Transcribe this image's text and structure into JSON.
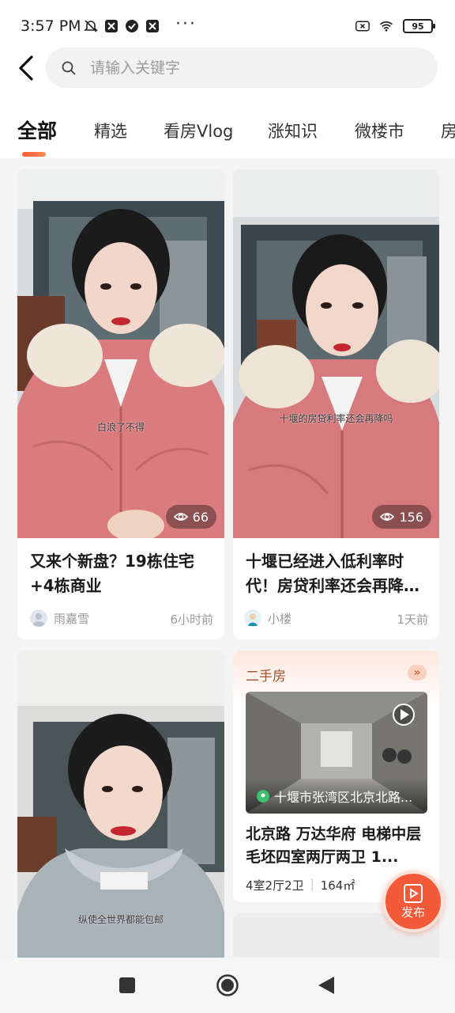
{
  "status_bar": {
    "time": "3:57 PM",
    "battery": "95",
    "dots": "···"
  },
  "search": {
    "placeholder": "请输入关键字"
  },
  "tabs": [
    {
      "label": "全部",
      "active": true
    },
    {
      "label": "精选"
    },
    {
      "label": "看房Vlog"
    },
    {
      "label": "涨知识"
    },
    {
      "label": "微楼市"
    },
    {
      "label": "房"
    }
  ],
  "cards": [
    {
      "title": "又来个新盘？19栋住宅+4栋商业",
      "subtitle_overlay": "白浪了不得",
      "views": "66",
      "author": "雨嘉雪",
      "time": "6小时前"
    },
    {
      "title": "十堰已经进入低利率时代！房贷利率还会再降…",
      "subtitle_overlay": "十堰的房贷利率还会再降吗",
      "views": "156",
      "author": "小楼",
      "time": "1天前"
    },
    {
      "subtitle_overlay": "纵使全世界都能包邮"
    }
  ],
  "house_card": {
    "tag": "二手房",
    "more_icon": "»",
    "location": "十堰市张湾区北京北路...",
    "title": "北京路 万达华府 电梯中层 毛坯四室两厅两卫 1...",
    "layout": "4室2厅2卫",
    "area": "164㎡"
  },
  "publish_button": {
    "label": "发布"
  },
  "colors": {
    "accent": "#f35a3a",
    "tab_indicator": "#ff5a2c",
    "house_tag": "#a2522f"
  }
}
